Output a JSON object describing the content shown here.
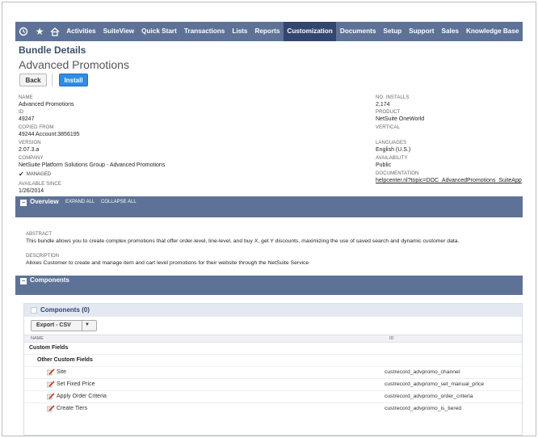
{
  "nav": {
    "items": [
      "Activities",
      "SuiteView",
      "Quick Start",
      "Transactions",
      "Lists",
      "Reports",
      "Customization",
      "Documents",
      "Setup",
      "Support",
      "Sales",
      "Knowledge Base"
    ],
    "active_index": 6,
    "icons": [
      "recent-icon",
      "star-icon",
      "home-icon"
    ]
  },
  "header": {
    "bundle_title": "Bundle Details",
    "record_title": "Advanced Promotions"
  },
  "buttons": {
    "back": "Back",
    "install": "Install"
  },
  "fields_left": [
    {
      "label": "NAME",
      "value": "Advanced Promotions"
    },
    {
      "label": "ID",
      "value": "49247"
    },
    {
      "label": "COPIED FROM",
      "value": "49244 Account:3856195"
    },
    {
      "label": "VERSION",
      "value": "2.07.3.a"
    },
    {
      "label": "COMPANY",
      "value": "NetSuite Platform Solutions Group - Advanced Promotions"
    },
    {
      "label": "AVAILABLE SINCE",
      "value": "1/26/2014"
    }
  ],
  "managed_label": "MANAGED",
  "fields_right": [
    {
      "label": "NO. INSTALLS",
      "value": "2,174"
    },
    {
      "label": "PRODUCT",
      "value": "NetSuite OneWorld"
    },
    {
      "label": "VERTICAL",
      "value": ""
    },
    {
      "label": "LANGUAGES",
      "value": "English (U.S.)"
    },
    {
      "label": "AVAILABILITY",
      "value": "Public"
    },
    {
      "label": "DOCUMENTATION",
      "value": "helpcenter.nl?topic=DOC_AdvancedPromotions_SuiteApp"
    }
  ],
  "overview": {
    "title": "Overview",
    "expand_all": "EXPAND ALL",
    "collapse_all": "COLLAPSE ALL",
    "abstract_label": "ABSTRACT",
    "abstract": "This bundle allows you to create complex promotions that offer order-level, line-level, and buy X, get Y discounts, maximizing the use of saved search and dynamic customer data.",
    "description_label": "DESCRIPTION",
    "description": "Allows Customer to create and manage item and cart level promotions for their website through the NetSuite Service"
  },
  "components": {
    "section_title": "Components",
    "box_title": "Components (0)",
    "export_label": "Export - CSV",
    "col_name": "NAME",
    "col_id": "ID",
    "group1": "Custom Fields",
    "group2": "Other Custom Fields",
    "rows": [
      {
        "name": "Site",
        "id": "custrecord_advpromo_channel"
      },
      {
        "name": "Set Fixed Price",
        "id": "custrecord_advpromo_set_manual_price"
      },
      {
        "name": "Apply Order Criteria",
        "id": "custrecord_advpromo_order_criteria"
      },
      {
        "name": "Create Tiers",
        "id": "custrecord_advpromo_is_tiered"
      }
    ]
  },
  "colors": {
    "nav_bg": "#5d7296",
    "nav_active": "#33466e",
    "install_btn": "#2f8ce3"
  }
}
